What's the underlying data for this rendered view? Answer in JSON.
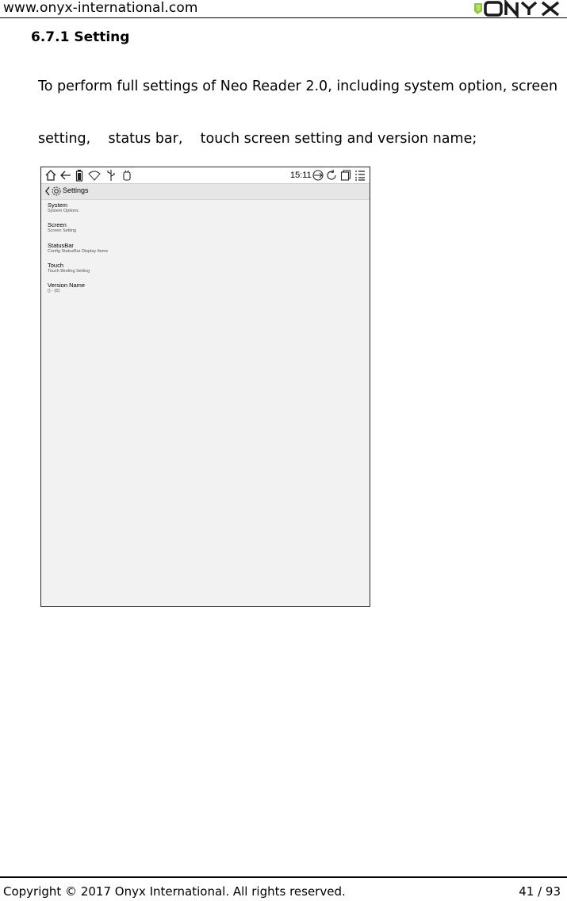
{
  "header": {
    "url": "www.onyx-international.com",
    "logo_text": "ONYX"
  },
  "section": {
    "title": "6.7.1 Setting",
    "paragraph_line1": "To perform full settings of Neo Reader 2.0, including system option, screen",
    "paragraph_line2": "setting,    status bar,    touch screen setting and version name;"
  },
  "device": {
    "status_bar": {
      "time": "15:11",
      "icons": [
        "home-icon",
        "back-arrow-icon",
        "battery-icon",
        "wifi-icon",
        "usb-icon",
        "app-icon",
        "refresh-mode-icon",
        "rotate-icon",
        "multi-window-icon",
        "menu-icon"
      ]
    },
    "title_bar": {
      "back_icon": "chevron-left-icon",
      "settings_icon": "gear-icon",
      "title": "Settings"
    },
    "items": [
      {
        "title": "System",
        "subtitle": "System Options"
      },
      {
        "title": "Screen",
        "subtitle": "Screen Setting"
      },
      {
        "title": "StatusBar",
        "subtitle": "Config StatusBar Display Items"
      },
      {
        "title": "Touch",
        "subtitle": "Touch Binding Setting"
      },
      {
        "title": "Version Name",
        "subtitle": "() - (0)"
      }
    ]
  },
  "footer": {
    "copyright": "Copyright © 2017 Onyx International. All rights reserved.",
    "page": "41 / 93"
  }
}
